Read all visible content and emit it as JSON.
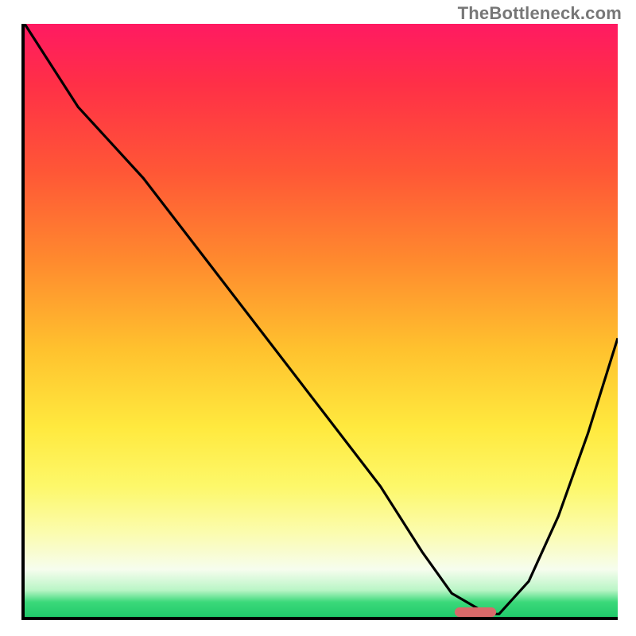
{
  "watermark": "TheBottleneck.com",
  "chart_data": {
    "type": "line",
    "title": "",
    "xlabel": "",
    "ylabel": "",
    "xlim": [
      0,
      100
    ],
    "ylim": [
      0,
      100
    ],
    "grid": false,
    "legend": false,
    "colors": {
      "curve": "#000000",
      "marker": "#d86a6a"
    },
    "background_gradient": {
      "orientation": "vertical",
      "stops": [
        {
          "pos": 0.0,
          "color": "#ff1a62"
        },
        {
          "pos": 0.1,
          "color": "#ff2f47"
        },
        {
          "pos": 0.25,
          "color": "#ff5736"
        },
        {
          "pos": 0.4,
          "color": "#ff8a2e"
        },
        {
          "pos": 0.55,
          "color": "#ffc22e"
        },
        {
          "pos": 0.68,
          "color": "#ffe93e"
        },
        {
          "pos": 0.78,
          "color": "#fdf86a"
        },
        {
          "pos": 0.86,
          "color": "#fbfcb0"
        },
        {
          "pos": 0.92,
          "color": "#f6fdee"
        },
        {
          "pos": 0.955,
          "color": "#b9f5c6"
        },
        {
          "pos": 0.975,
          "color": "#3bd97a"
        },
        {
          "pos": 1.0,
          "color": "#20c96a"
        }
      ]
    },
    "series": [
      {
        "name": "bottleneck-curve",
        "x": [
          0,
          9,
          20,
          30,
          40,
          50,
          60,
          67,
          72,
          78,
          80,
          85,
          90,
          95,
          100
        ],
        "y": [
          100,
          86,
          74,
          61,
          48,
          35,
          22,
          11,
          4,
          0.5,
          0.5,
          6,
          17,
          31,
          47
        ]
      }
    ],
    "marker": {
      "x_range": [
        72.5,
        79.5
      ],
      "y": 0.8,
      "shape": "rounded-bar"
    }
  }
}
